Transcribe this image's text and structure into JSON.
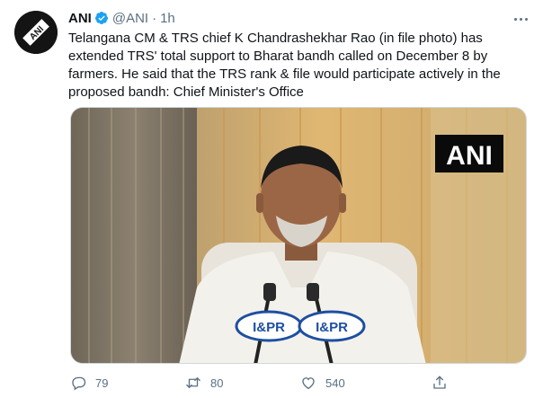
{
  "tweet": {
    "author_name": "ANI",
    "handle": "@ANI",
    "separator": "·",
    "time": "1h",
    "text": "Telangana CM & TRS chief K Chandrashekhar Rao (in file photo) has\nextended TRS' total support to Bharat bandh called on December 8 by\nfarmers. He said that the TRS rank & file would participate actively in the\nproposed bandh: Chief Minister's Office",
    "avatar_logo_text": "ANI"
  },
  "media": {
    "watermark": "ANI",
    "mic_labels": [
      "I&PR",
      "I&PR"
    ]
  },
  "actions": {
    "replies": "79",
    "retweets": "80",
    "likes": "540"
  },
  "colors": {
    "text": "#0f1419",
    "secondary": "#5b7083",
    "verified": "#1da1f2",
    "border": "#cfd9de"
  }
}
